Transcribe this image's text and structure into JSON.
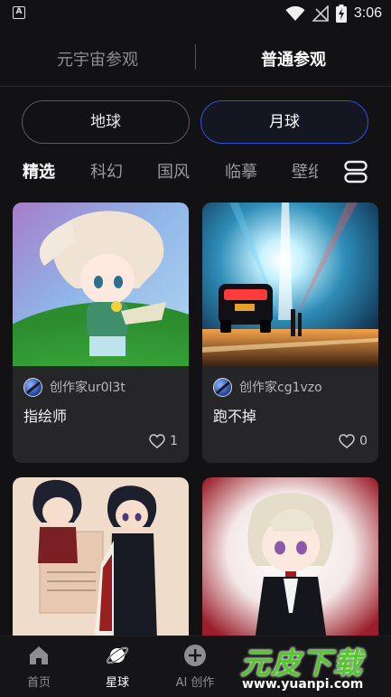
{
  "status_bar": {
    "time": "3:06"
  },
  "top_tabs": [
    {
      "label": "元宇宙参观"
    },
    {
      "label": "普通参观"
    }
  ],
  "planet_toggle": [
    {
      "label": "地球"
    },
    {
      "label": "月球"
    }
  ],
  "categories": [
    {
      "label": "精选"
    },
    {
      "label": "科幻"
    },
    {
      "label": "国风"
    },
    {
      "label": "临摹"
    },
    {
      "label": "壁纸"
    }
  ],
  "works": [
    {
      "author": "创作家ur0l3t",
      "title": "指绘师",
      "likes": "1"
    },
    {
      "author": "创作家cg1vzo",
      "title": "跑不掉",
      "likes": "0"
    },
    {
      "author": "",
      "title": "",
      "likes": ""
    },
    {
      "author": "",
      "title": "",
      "likes": ""
    }
  ],
  "bottom_nav": [
    {
      "label": "首页",
      "icon": "home-icon"
    },
    {
      "label": "星球",
      "icon": "planet-icon"
    },
    {
      "label": "AI 创作",
      "icon": "add-circle-icon"
    }
  ],
  "watermark": {
    "logo": "元皮下载",
    "url": "www.yuanpi.com"
  },
  "colors": {
    "accent": "#2f54d6",
    "background": "#121214",
    "card": "#262628"
  }
}
